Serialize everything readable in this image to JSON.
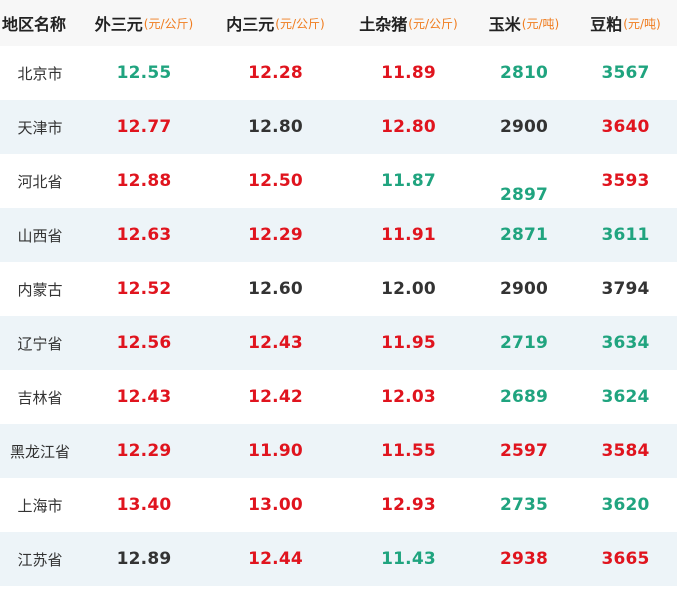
{
  "headers": [
    {
      "name": "地区名称",
      "unit": ""
    },
    {
      "name": "外三元",
      "unit": "(元/公斤)"
    },
    {
      "name": "内三元",
      "unit": "(元/公斤)"
    },
    {
      "name": "土杂猪",
      "unit": "(元/公斤)"
    },
    {
      "name": "玉米",
      "unit": "(元/吨)"
    },
    {
      "name": "豆粕",
      "unit": "(元/吨)"
    }
  ],
  "rows": [
    {
      "region": "北京市",
      "cells": [
        {
          "value": "12.55",
          "color": "green"
        },
        {
          "value": "12.28",
          "color": "red"
        },
        {
          "value": "11.89",
          "color": "red"
        },
        {
          "value": "2810",
          "color": "green"
        },
        {
          "value": "3567",
          "color": "green"
        }
      ]
    },
    {
      "region": "天津市",
      "cells": [
        {
          "value": "12.77",
          "color": "red"
        },
        {
          "value": "12.80",
          "color": "black"
        },
        {
          "value": "12.80",
          "color": "red"
        },
        {
          "value": "2900",
          "color": "black"
        },
        {
          "value": "3640",
          "color": "red"
        }
      ]
    },
    {
      "region": "河北省",
      "cells": [
        {
          "value": "12.88",
          "color": "red"
        },
        {
          "value": "12.50",
          "color": "red"
        },
        {
          "value": "11.87",
          "color": "green"
        },
        {
          "value": "2897",
          "color": "green"
        },
        {
          "value": "3593",
          "color": "red"
        }
      ]
    },
    {
      "region": "山西省",
      "cells": [
        {
          "value": "12.63",
          "color": "red"
        },
        {
          "value": "12.29",
          "color": "red"
        },
        {
          "value": "11.91",
          "color": "red"
        },
        {
          "value": "2871",
          "color": "green"
        },
        {
          "value": "3611",
          "color": "green"
        }
      ]
    },
    {
      "region": "内蒙古",
      "cells": [
        {
          "value": "12.52",
          "color": "red"
        },
        {
          "value": "12.60",
          "color": "black"
        },
        {
          "value": "12.00",
          "color": "black"
        },
        {
          "value": "2900",
          "color": "black"
        },
        {
          "value": "3794",
          "color": "black"
        }
      ]
    },
    {
      "region": "辽宁省",
      "cells": [
        {
          "value": "12.56",
          "color": "red"
        },
        {
          "value": "12.43",
          "color": "red"
        },
        {
          "value": "11.95",
          "color": "red"
        },
        {
          "value": "2719",
          "color": "green"
        },
        {
          "value": "3634",
          "color": "green"
        }
      ]
    },
    {
      "region": "吉林省",
      "cells": [
        {
          "value": "12.43",
          "color": "red"
        },
        {
          "value": "12.42",
          "color": "red"
        },
        {
          "value": "12.03",
          "color": "red"
        },
        {
          "value": "2689",
          "color": "green"
        },
        {
          "value": "3624",
          "color": "green"
        }
      ]
    },
    {
      "region": "黑龙江省",
      "cells": [
        {
          "value": "12.29",
          "color": "red"
        },
        {
          "value": "11.90",
          "color": "red"
        },
        {
          "value": "11.55",
          "color": "red"
        },
        {
          "value": "2597",
          "color": "red"
        },
        {
          "value": "3584",
          "color": "red"
        }
      ]
    },
    {
      "region": "上海市",
      "cells": [
        {
          "value": "13.40",
          "color": "red"
        },
        {
          "value": "13.00",
          "color": "red"
        },
        {
          "value": "12.93",
          "color": "red"
        },
        {
          "value": "2735",
          "color": "green"
        },
        {
          "value": "3620",
          "color": "green"
        }
      ]
    },
    {
      "region": "江苏省",
      "cells": [
        {
          "value": "12.89",
          "color": "black"
        },
        {
          "value": "12.44",
          "color": "red"
        },
        {
          "value": "11.43",
          "color": "green"
        },
        {
          "value": "2938",
          "color": "red"
        },
        {
          "value": "3665",
          "color": "red"
        }
      ]
    }
  ]
}
